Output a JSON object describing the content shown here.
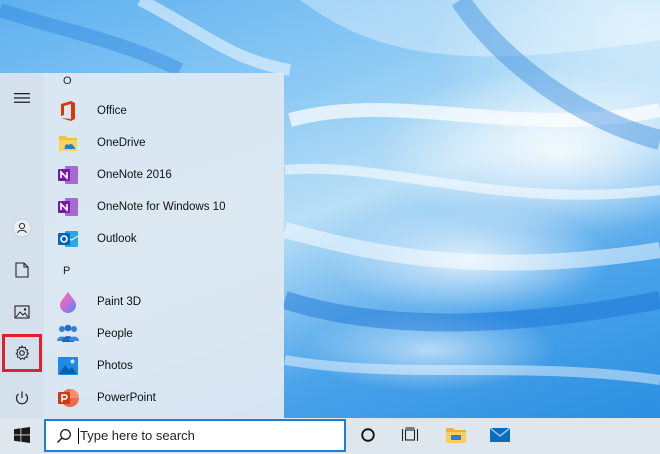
{
  "start_menu": {
    "sections": [
      {
        "letter": "O",
        "apps": [
          {
            "label": "Office",
            "icon": "office-icon"
          },
          {
            "label": "OneDrive",
            "icon": "onedrive-icon"
          },
          {
            "label": "OneNote 2016",
            "icon": "onenote-icon"
          },
          {
            "label": "OneNote for Windows 10",
            "icon": "onenote-icon"
          },
          {
            "label": "Outlook",
            "icon": "outlook-icon"
          }
        ]
      },
      {
        "letter": "P",
        "apps": [
          {
            "label": "Paint 3D",
            "icon": "paint3d-icon"
          },
          {
            "label": "People",
            "icon": "people-icon"
          },
          {
            "label": "Photos",
            "icon": "photos-icon"
          },
          {
            "label": "PowerPoint",
            "icon": "powerpoint-icon"
          }
        ]
      }
    ],
    "rail": [
      "hamburger-menu-icon",
      "user-icon",
      "document-icon",
      "pictures-icon",
      "settings-icon",
      "power-icon"
    ],
    "highlight_color": "#e0202a"
  },
  "taskbar": {
    "search_placeholder": "Type here to search",
    "icons": [
      "windows-logo-icon",
      "cortana-icon",
      "task-view-icon",
      "file-explorer-icon",
      "mail-icon"
    ],
    "accent": "#1e7fd6"
  }
}
